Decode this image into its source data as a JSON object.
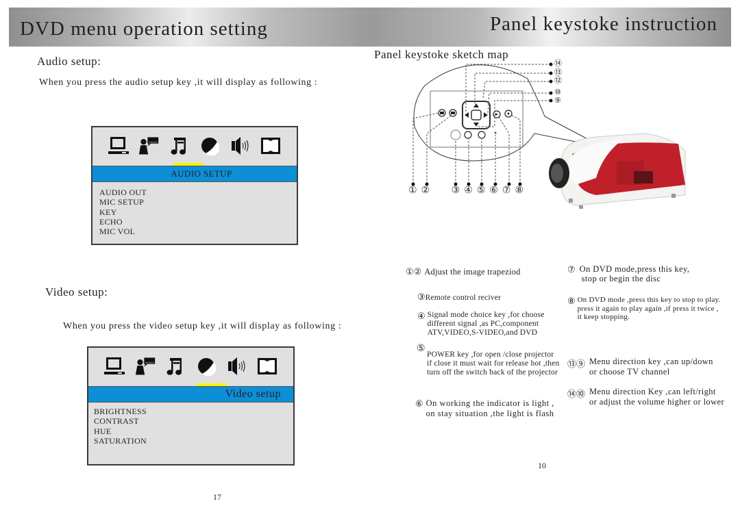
{
  "left_page": {
    "banner_title": "DVD menu operation setting",
    "audio": {
      "heading": "Audio setup:",
      "intro": "When you press the audio setup key ,it will display as following :",
      "osd": {
        "icons": [
          "monitor-icon",
          "person-speech-icon",
          "music-note-icon",
          "contrast-icon",
          "speaker-icon",
          "dolby-icon"
        ],
        "selected_icon_index": 2,
        "bar_title": "AUDIO SETUP",
        "items": [
          "AUDIO OUT",
          "MIC SETUP",
          "KEY",
          "ECHO",
          "MIC VOL"
        ]
      }
    },
    "video": {
      "heading": "Video setup:",
      "intro": "When you press the video setup key ,it will display as following :",
      "osd": {
        "icons": [
          "monitor-icon",
          "person-speech-icon",
          "music-note-icon",
          "contrast-icon",
          "speaker-icon",
          "dolby-icon"
        ],
        "selected_icon_index": 3,
        "bar_title": "Video setup",
        "items": [
          "BRIGHTNESS",
          "CONTRAST",
          "HUE",
          "SATURATION"
        ]
      }
    },
    "page_number": "17"
  },
  "right_page": {
    "banner_title": "Panel keystoke instruction",
    "sketch_title": "Panel keystoke sketch map",
    "callouts_bottom": [
      "①",
      "②",
      "③",
      "④",
      "⑤",
      "⑥",
      "⑦",
      "⑧"
    ],
    "callouts_right": [
      "⑭",
      "⑬",
      "⑫",
      "⑩",
      "⑨"
    ],
    "legend": [
      {
        "nums": [
          "①",
          "②"
        ],
        "lines": [
          "Adjust the image trapeziod"
        ]
      },
      {
        "nums": [
          "③"
        ],
        "lines": [
          "Remote control reciver"
        ]
      },
      {
        "nums": [
          "④"
        ],
        "lines": [
          "Signal mode choice key ,for choose",
          "different signal ,as PC,component",
          "ATV,VIDEO,S-VIDEO,and DVD"
        ]
      },
      {
        "nums": [
          "⑤"
        ],
        "lines": [
          "POWER key ,for open /close projector",
          "if close it must wait for release hot ,then",
          "turn off the switch back of the projector"
        ]
      },
      {
        "nums": [
          "⑥"
        ],
        "lines": [
          "On working the indicator is light ,",
          "on stay situation ,the light is flash"
        ]
      },
      {
        "nums": [
          "⑦"
        ],
        "lines": [
          "On DVD mode,press this key,",
          "stop or begin the disc"
        ]
      },
      {
        "nums": [
          "⑧"
        ],
        "lines": [
          "On DVD mode ,press this key to stop to play.",
          "press it again to play again ,if press it twice ,",
          "it keep stopping."
        ]
      },
      {
        "nums": [
          "⑬",
          "⑨"
        ],
        "lines": [
          "Menu direction key ,can up/down",
          "or choose TV channel"
        ]
      },
      {
        "nums": [
          "⑭",
          "⑩"
        ],
        "lines": [
          "Menu direction Key ,can left/right",
          "or adjust the volume higher or lower"
        ]
      }
    ],
    "page_number": "10"
  }
}
